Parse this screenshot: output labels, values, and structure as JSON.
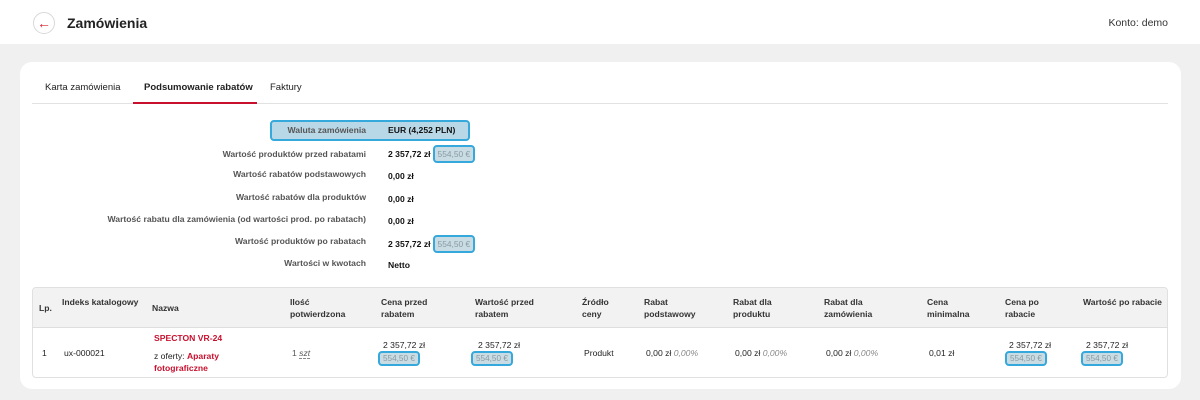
{
  "header": {
    "back_icon": "arrow-left-icon",
    "title": "Zamówienia",
    "account": "Konto: demo"
  },
  "tabs": [
    {
      "label": "Karta zamówienia"
    },
    {
      "label": "Podsumowanie rabatów",
      "active": true
    },
    {
      "label": "Faktury"
    }
  ],
  "summary": [
    {
      "label": "Waluta zamówienia",
      "value": "EUR (4,252 PLN)",
      "highlight": true
    },
    {
      "label": "Wartość produktów przed rabatami",
      "value": "2 357,72 zł",
      "eur": "554,50 €"
    },
    {
      "label": "Wartość rabatów podstawowych",
      "value": "0,00 zł"
    },
    {
      "label": "Wartość rabatów dla produktów",
      "value": "0,00 zł"
    },
    {
      "label": "Wartość rabatu dla zamówienia (od wartości prod. po rabatach)",
      "value": "0,00 zł"
    },
    {
      "label": "Wartość produktów po rabatach",
      "value": "2 357,72 zł",
      "eur": "554,50 €"
    },
    {
      "label": "Wartości w kwotach",
      "value": "Netto"
    }
  ],
  "table": {
    "headers": {
      "lp": "Lp.",
      "index": "Indeks katalogowy",
      "name": "Nazwa",
      "qty": "Ilość potwierdzona",
      "price_before": "Cena przed rabatem",
      "value_before": "Wartość przed rabatem",
      "source": "Źródło ceny",
      "disc_basic": "Rabat podstawowy",
      "disc_product": "Rabat dla produktu",
      "disc_order": "Rabat dla zamówienia",
      "min_price": "Cena minimalna",
      "price_after": "Cena po rabacie",
      "value_after": "Wartość po rabacie"
    },
    "row": {
      "lp": "1",
      "index": "ux-000021",
      "name": "SPECTON VR-24",
      "offer_prefix": "z oferty:",
      "offer_link": "Aparaty fotograficzne",
      "qty": "1",
      "qty_unit": "szt",
      "price_before": "2 357,72 zł",
      "price_before_eur": "554,50 €",
      "value_before": "2 357,72 zł",
      "value_before_eur": "554,50 €",
      "source": "Produkt",
      "disc_basic": "0,00 zł",
      "disc_basic_pct": "0,00%",
      "disc_product": "0,00 zł",
      "disc_product_pct": "0,00%",
      "disc_order": "0,00 zł",
      "disc_order_pct": "0,00%",
      "min_price": "0,01 zł",
      "price_after": "2 357,72 zł",
      "price_after_eur": "554,50 €",
      "value_after": "2 357,72 zł",
      "value_after_eur": "554,50 €"
    }
  },
  "colors": {
    "accent": "#c8102e",
    "highlight_border": "#35a8dc",
    "highlight_fill": "#b9d8e7"
  }
}
